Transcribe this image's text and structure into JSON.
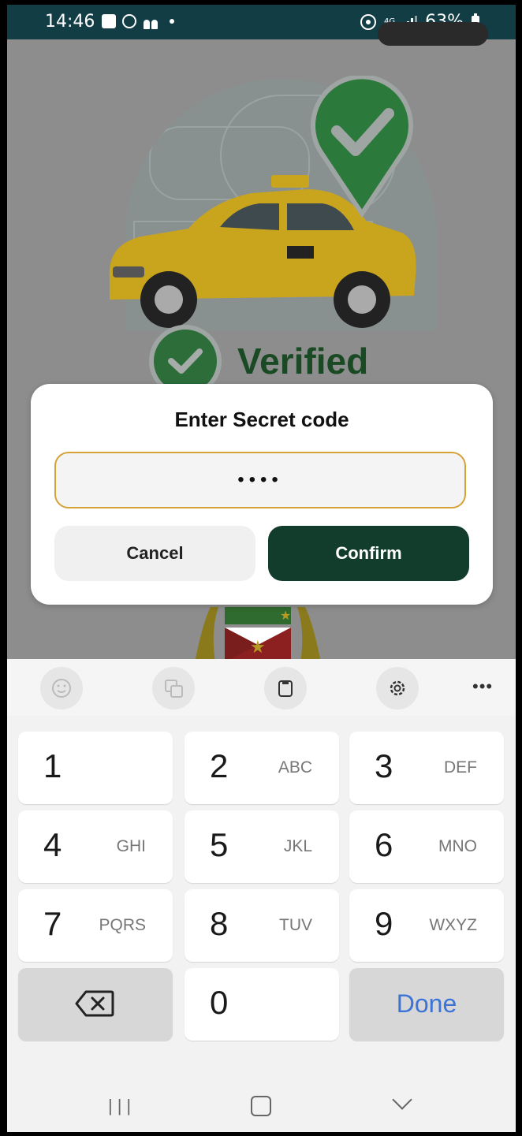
{
  "status_bar": {
    "time": "14:46",
    "network": "4G",
    "battery": "63%"
  },
  "background": {
    "verified_label": "Verified"
  },
  "dialog": {
    "title": "Enter Secret code",
    "code_value": "••••",
    "cancel_label": "Cancel",
    "confirm_label": "Confirm"
  },
  "keyboard": {
    "keys": [
      {
        "num": "1",
        "letters": ""
      },
      {
        "num": "2",
        "letters": "ABC"
      },
      {
        "num": "3",
        "letters": "DEF"
      },
      {
        "num": "4",
        "letters": "GHI"
      },
      {
        "num": "5",
        "letters": "JKL"
      },
      {
        "num": "6",
        "letters": "MNO"
      },
      {
        "num": "7",
        "letters": "PQRS"
      },
      {
        "num": "8",
        "letters": "TUV"
      },
      {
        "num": "9",
        "letters": "WXYZ"
      },
      {
        "num": "0",
        "letters": ""
      }
    ],
    "done_label": "Done",
    "toolbar_icons": [
      "emoji-icon",
      "translate-icon",
      "clipboard-icon",
      "settings-icon",
      "more-icon"
    ]
  },
  "colors": {
    "status_bar": "#123d45",
    "confirm_button": "#123c2c",
    "input_border": "#d5a235",
    "done_text": "#3b73d6"
  }
}
